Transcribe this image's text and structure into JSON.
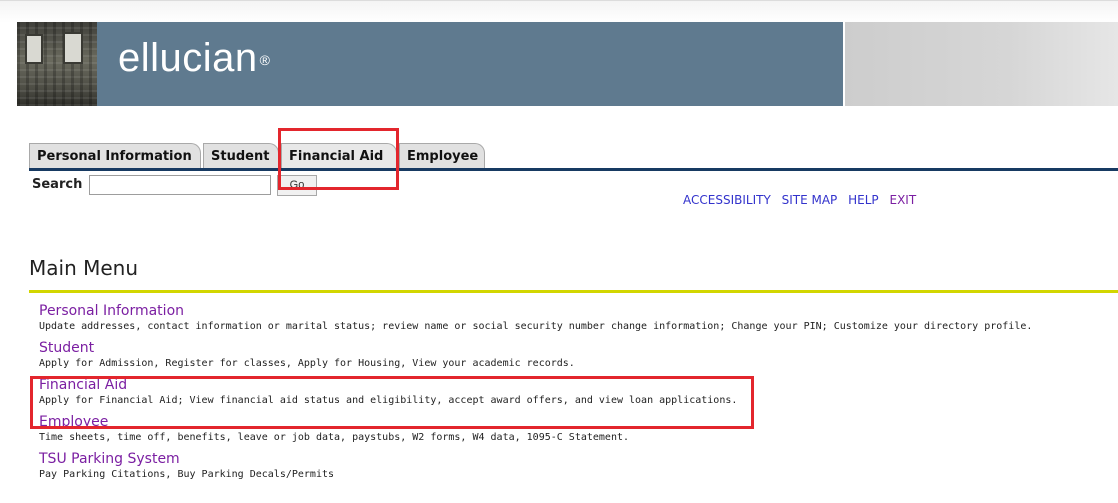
{
  "header": {
    "logo_text": "ellucian",
    "logo_mark": "®"
  },
  "tabs": [
    {
      "label": "Personal Information"
    },
    {
      "label": "Student"
    },
    {
      "label": "Financial Aid"
    },
    {
      "label": "Employee"
    }
  ],
  "search": {
    "label": "Search",
    "value": "",
    "button_label": "Go"
  },
  "utility_links": {
    "accessibility": "ACCESSIBILITY",
    "site_map": "SITE MAP",
    "help": "HELP",
    "exit": "EXIT"
  },
  "page_title": "Main Menu",
  "menu": [
    {
      "label": "Personal Information",
      "description": "Update addresses, contact information or marital status; review name or social security number change information; Change your PIN; Customize your directory profile."
    },
    {
      "label": "Student",
      "description": "Apply for Admission, Register for classes, Apply for Housing, View your academic records."
    },
    {
      "label": "Financial Aid",
      "description": "Apply for Financial Aid; View financial aid status and eligibility, accept award offers, and view loan applications."
    },
    {
      "label": "Employee",
      "description": "Time sheets, time off, benefits, leave or job data, paystubs, W2 forms, W4 data, 1095-C Statement."
    },
    {
      "label": "TSU Parking System",
      "description": "Pay Parking Citations, Buy Parking Decals/Permits"
    }
  ],
  "colors": {
    "banner": "#5f7a8f",
    "tab_underline": "#173a62",
    "menu_rule": "#d2d600",
    "link_purple": "#7b1fa2",
    "utility_blue": "#3333cc",
    "highlight_red": "#e3262d"
  }
}
